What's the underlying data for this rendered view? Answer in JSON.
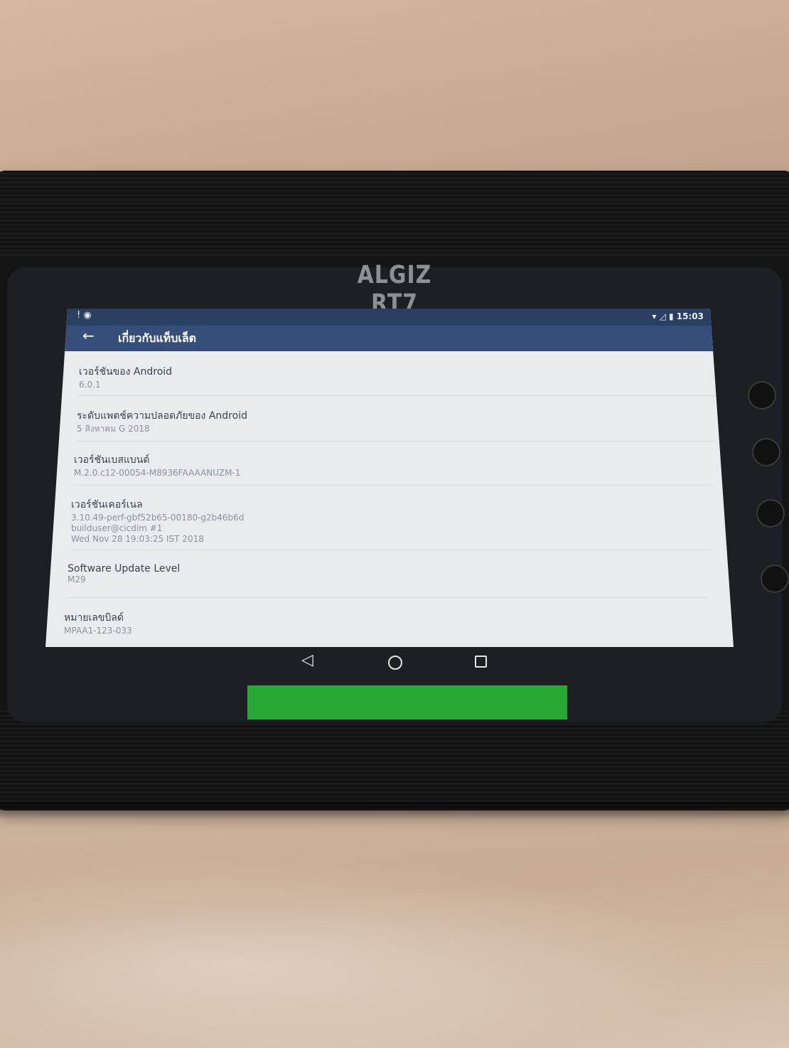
{
  "device": {
    "brand_label": "ALGIZ RT7"
  },
  "statusbar": {
    "left_icons": "! ◉",
    "time": "15:03"
  },
  "appbar": {
    "back_icon": "arrow-left-icon",
    "title": "เกี่ยวกับแท็บเล็ต"
  },
  "settings": {
    "items": [
      {
        "title": "เวอร์ชันของ Android",
        "value": "6.0.1"
      },
      {
        "title": "ระดับแพตช์ความปลอดภัยของ Android",
        "value": "5 สิงหาคม G 2018"
      },
      {
        "title": "เวอร์ชันเบสแบนด์",
        "value": "M.2.0.c12-00054-M8936FAAAANUZM-1"
      },
      {
        "title": "เวอร์ชันเคอร์เนล",
        "value_lines": [
          "3.10.49-perf-gbf52b65-00180-g2b46b6d",
          "builduser@cicdim #1",
          "Wed Nov 28 19:03:25 IST 2018"
        ]
      },
      {
        "title": "Software Update Level",
        "value": "M29"
      },
      {
        "title": "หมายเลขบิลด์",
        "value": "MPAA1-123-033"
      }
    ]
  },
  "navbar": {
    "back": "◁",
    "home_icon": "home-circle-icon",
    "recents_icon": "recents-square-icon"
  },
  "colors": {
    "appbar": "#354f7a",
    "statusbar": "#2b3f63",
    "screen_bg": "#e9ecef",
    "green_tag": "#27a834"
  }
}
